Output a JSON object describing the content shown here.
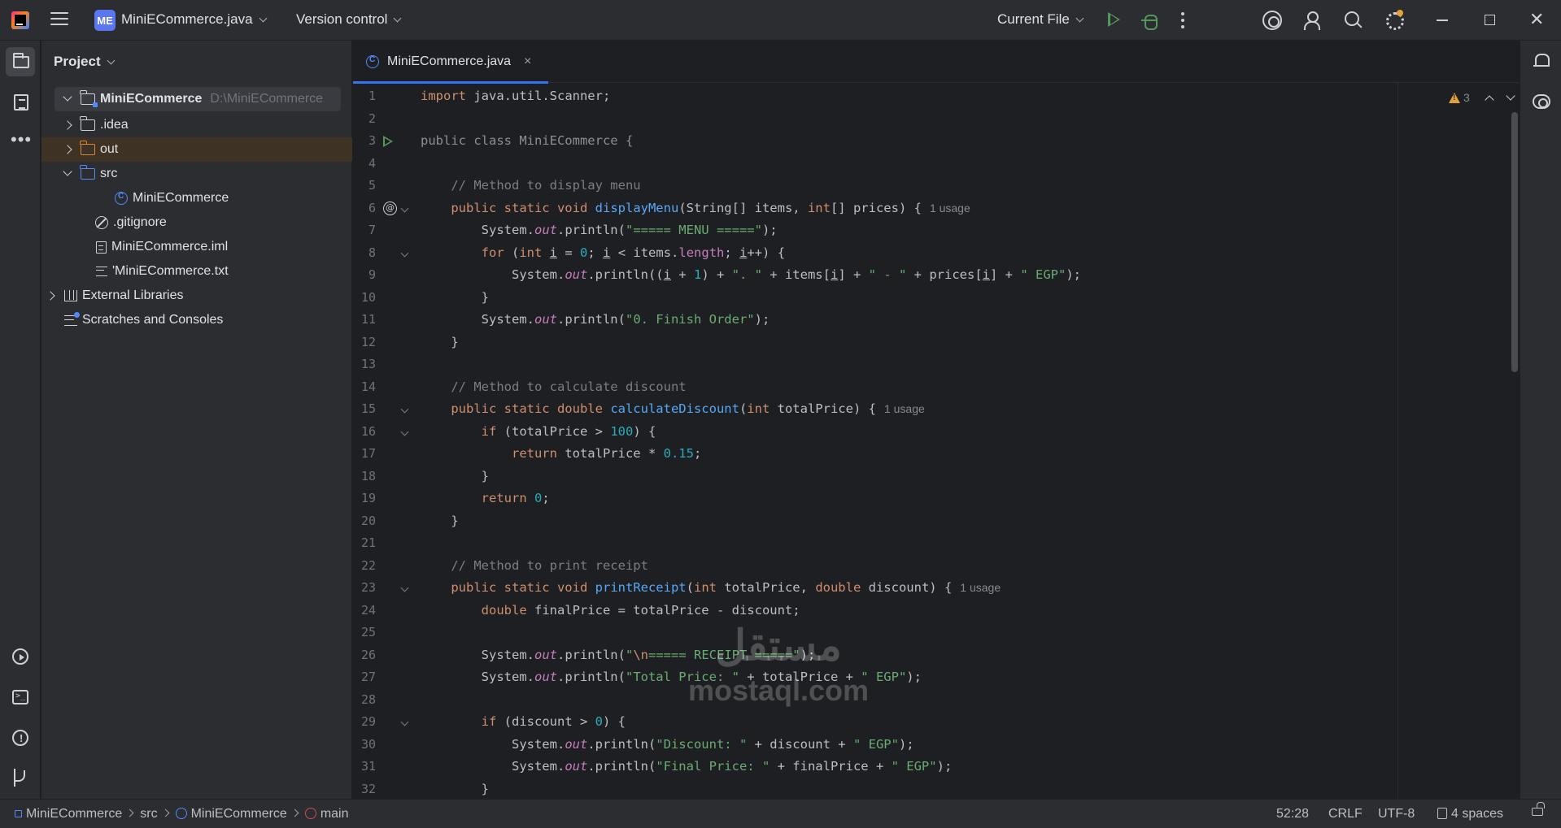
{
  "titlebar": {
    "project_badge": "ME",
    "project_name": "MiniECommerce.java",
    "vcs_label": "Version control",
    "run_config": "Current File"
  },
  "project_panel": {
    "title": "Project",
    "tree": [
      {
        "label": "MiniECommerce",
        "hint": "D:\\MiniECommerce"
      },
      {
        "label": ".idea"
      },
      {
        "label": "out"
      },
      {
        "label": "src"
      },
      {
        "label": "MiniECommerce"
      },
      {
        "label": ".gitignore"
      },
      {
        "label": "MiniECommerce.iml"
      },
      {
        "label": "'MiniECommerce.txt"
      },
      {
        "label": "External Libraries"
      },
      {
        "label": "Scratches and Consoles"
      }
    ]
  },
  "editor": {
    "tab_label": "MiniECommerce.java",
    "tab_close": "×",
    "warnings_count": "3",
    "usage_hint": "1 usage",
    "line_numbers": [
      "1",
      "2",
      "3",
      "4",
      "5",
      "6",
      "7",
      "8",
      "9",
      "10",
      "11",
      "12",
      "13",
      "14",
      "15",
      "16",
      "17",
      "18",
      "19",
      "20",
      "21",
      "22",
      "23",
      "24",
      "25",
      "26",
      "27",
      "28",
      "29",
      "30",
      "31",
      "32"
    ]
  },
  "watermark": {
    "arabic": "مستقل",
    "latin": "mostaql.com"
  },
  "statusbar": {
    "crumb_project": "MiniECommerce",
    "crumb_src": "src",
    "crumb_class": "MiniECommerce",
    "crumb_method": "main",
    "position": "52:28",
    "line_sep": "CRLF",
    "encoding": "UTF-8",
    "indent": "4 spaces"
  },
  "colors": {
    "keyword": "#cf8e6d",
    "string": "#6aab73",
    "number": "#2aacb8",
    "comment": "#7a7e85",
    "function": "#56a8f5",
    "static_field": "#c77dbb",
    "accent": "#3574f0"
  }
}
